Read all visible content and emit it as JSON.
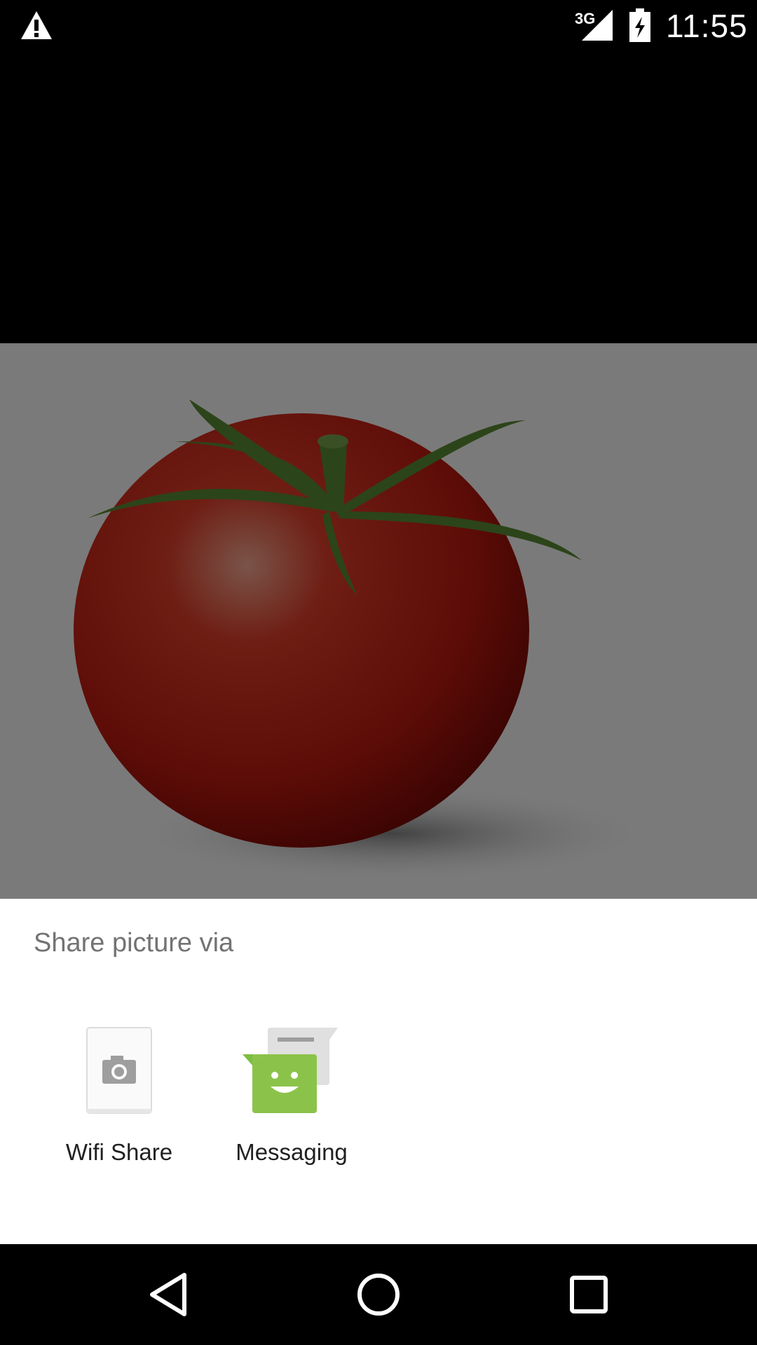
{
  "status_bar": {
    "network": "3G",
    "time": "11:55",
    "icons": [
      "warning-icon",
      "signal-icon",
      "battery-charging-icon"
    ]
  },
  "share_sheet": {
    "title": "Share picture via",
    "targets": [
      {
        "label": "Wifi Share",
        "icon": "camera-icon"
      },
      {
        "label": "Messaging",
        "icon": "messaging-icon"
      }
    ]
  },
  "nav_bar": {
    "icons": [
      "back-icon",
      "home-icon",
      "recents-icon"
    ]
  }
}
